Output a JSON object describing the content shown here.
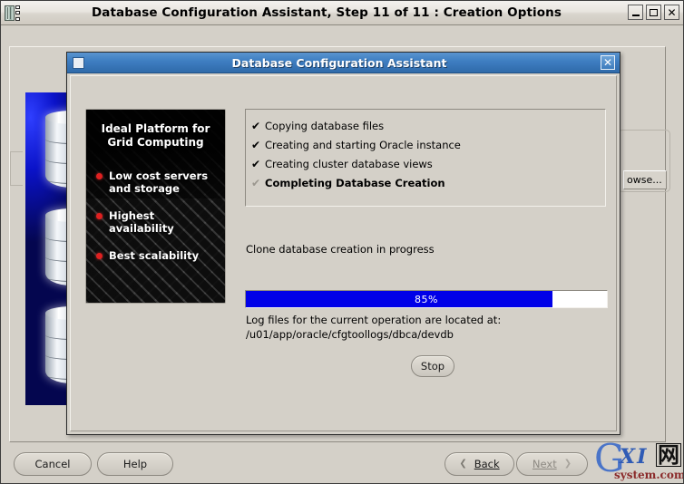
{
  "outer_window": {
    "title": "Database Configuration Assistant, Step 11 of 11 : Creation Options",
    "icon": "app-icon",
    "controls": {
      "minimize": "_",
      "maximize": "□",
      "close": "✕"
    }
  },
  "background_window": {
    "obscured_title_fragments": "– – – – – –",
    "browse_button": "owse...",
    "graphic": "database-cylinders-graphic"
  },
  "footer": {
    "cancel_label": "Cancel",
    "help_label": "Help",
    "back_label": "Back",
    "back_mnemonic": "B",
    "next_label": "Next",
    "next_mnemonic": "N",
    "next_disabled": true,
    "back_chevron": "❮",
    "next_chevron": "❯"
  },
  "dialog": {
    "title": "Database Configuration Assistant",
    "close_glyph": "✕",
    "promo": {
      "headline_line1": "Ideal Platform for",
      "headline_line2": "Grid Computing",
      "bullets": [
        "Low cost servers and storage",
        "Highest availability",
        "Best scalability"
      ]
    },
    "steps": [
      {
        "label": "Copying database files",
        "state": "done",
        "tick": "✔"
      },
      {
        "label": "Creating and starting Oracle instance",
        "state": "done",
        "tick": "✔"
      },
      {
        "label": "Creating cluster database views",
        "state": "done",
        "tick": "✔"
      },
      {
        "label": "Completing Database Creation",
        "state": "active",
        "tick": "✔"
      }
    ],
    "status_text": "Clone database creation in progress",
    "progress": {
      "percent": 85,
      "label": "85%",
      "fill_color": "#0000e8",
      "track_color": "#ffffff"
    },
    "log_line_1": "Log files for the current operation are located at:",
    "log_line_2": "/u01/app/oracle/cfgtoollogs/dbca/devdb",
    "stop_label": "Stop"
  },
  "watermark": {
    "g": "G",
    "xi": "XI",
    "cjk": "网",
    "domain": "system.com"
  }
}
